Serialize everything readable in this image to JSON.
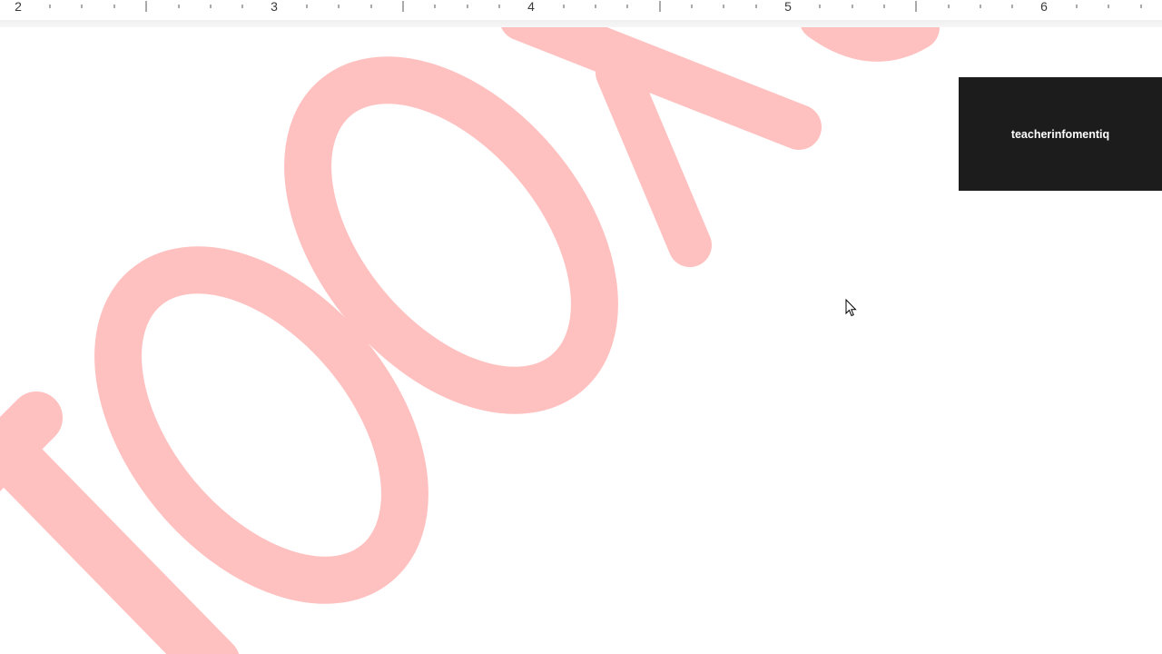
{
  "ruler": {
    "labels": [
      "2",
      "3",
      "4",
      "5",
      "6"
    ]
  },
  "watermark": {
    "color": "#ffc0c0"
  },
  "overlay": {
    "channel_name": "teacherinfomentiq"
  },
  "icons": {
    "cursor": "mouse-pointer-icon"
  }
}
